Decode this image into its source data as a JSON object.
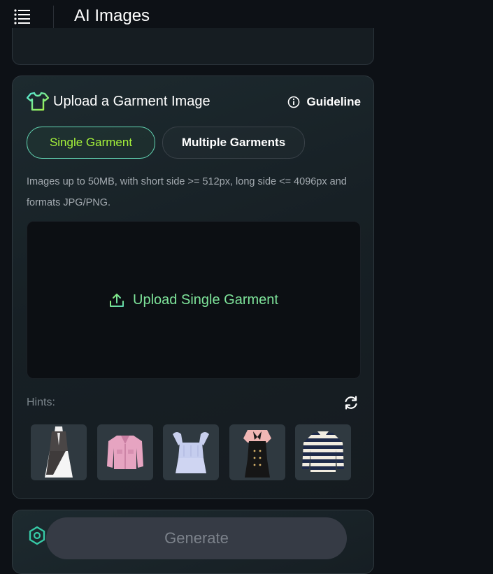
{
  "header": {
    "title": "AI Images",
    "menu_icon": "hamburger-menu-icon"
  },
  "upload_card": {
    "title": "Upload a Garment Image",
    "title_icon": "tshirt-icon",
    "guideline_label": "Guideline",
    "guideline_icon": "info-icon",
    "tabs": [
      {
        "label": "Single Garment",
        "selected": true
      },
      {
        "label": "Multiple Garments",
        "selected": false
      }
    ],
    "requirements": "Images up to 50MB, with short side >= 512px, long side <= 4096px and formats JPG/PNG.",
    "dropzone_label": "Upload Single Garment",
    "dropzone_icon": "upload-icon",
    "hints_label": "Hints:",
    "refresh_icon": "refresh-icon",
    "hint_items": [
      {
        "name": "grey-vest-dress-with-white-skirt"
      },
      {
        "name": "pink-denim-jacket"
      },
      {
        "name": "light-blue-ruffled-top"
      },
      {
        "name": "black-dress-with-pink-collar"
      },
      {
        "name": "navy-white-striped-sweater"
      }
    ]
  },
  "generate_card": {
    "button_label": "Generate",
    "coin_icon": "hexagon-coin-icon"
  },
  "colors": {
    "background": "#0d1116",
    "accent_green": "#a6f33a",
    "accent_teal": "#63d6b4",
    "upload_text": "#7ee39a",
    "muted_text": "#a3aab0",
    "button_disabled": "#363b45"
  }
}
